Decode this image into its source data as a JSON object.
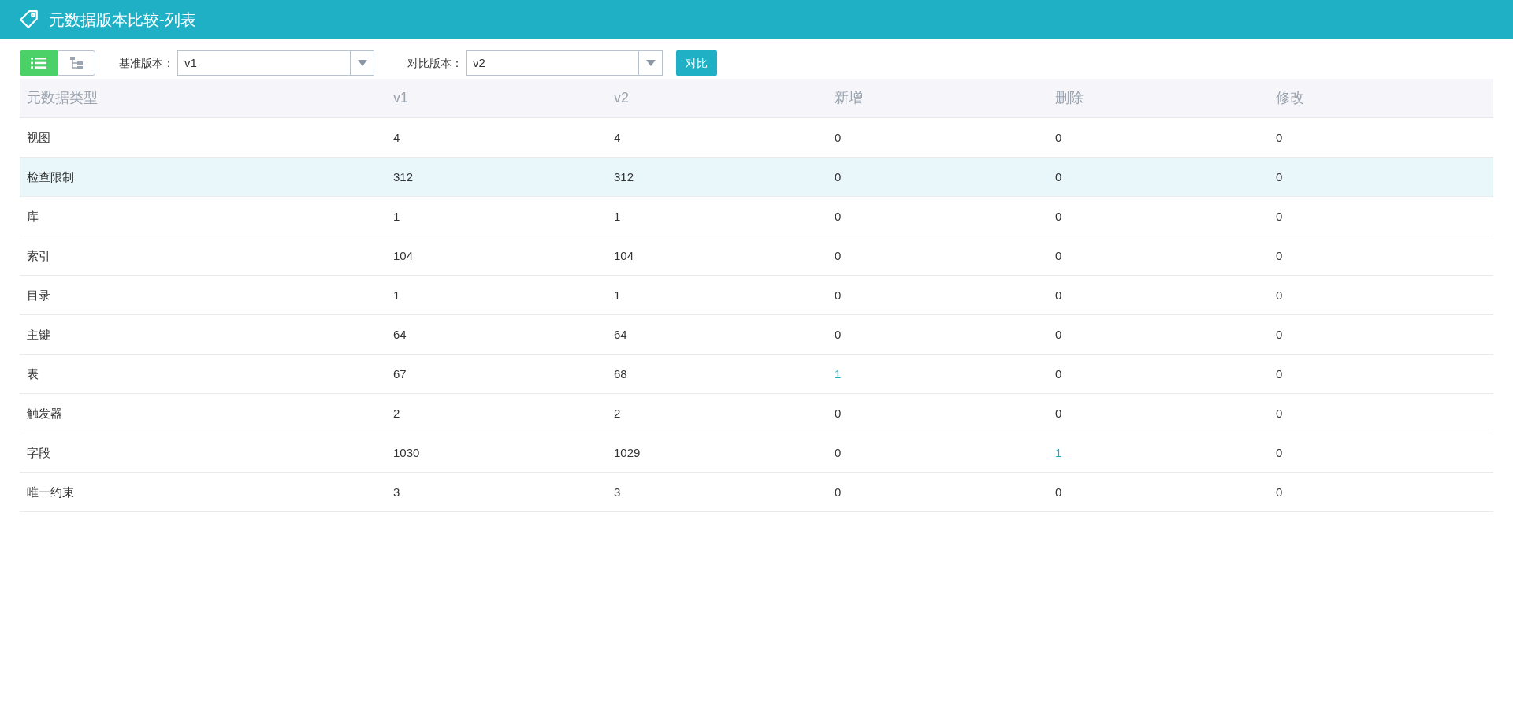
{
  "header": {
    "title": "元数据版本比较-列表"
  },
  "view_toggle": [
    {
      "kind": "list",
      "selected": true
    },
    {
      "kind": "tree",
      "selected": false
    }
  ],
  "base_version": {
    "label": "基准版本：",
    "value": "v1"
  },
  "compare_version": {
    "label": "对比版本：",
    "value": "v2"
  },
  "compare_button": "对比",
  "table": {
    "columns": [
      "元数据类型",
      "v1",
      "v2",
      "新增",
      "删除",
      "修改"
    ],
    "rows": [
      {
        "highlighted": false,
        "cells": [
          {
            "text": "视图",
            "link": false
          },
          {
            "text": "4",
            "link": false
          },
          {
            "text": "4",
            "link": false
          },
          {
            "text": "0",
            "link": false
          },
          {
            "text": "0",
            "link": false
          },
          {
            "text": "0",
            "link": false
          }
        ]
      },
      {
        "highlighted": true,
        "cells": [
          {
            "text": "检查限制",
            "link": false
          },
          {
            "text": "312",
            "link": false
          },
          {
            "text": "312",
            "link": false
          },
          {
            "text": "0",
            "link": false
          },
          {
            "text": "0",
            "link": false
          },
          {
            "text": "0",
            "link": false
          }
        ]
      },
      {
        "highlighted": false,
        "cells": [
          {
            "text": "库",
            "link": false
          },
          {
            "text": "1",
            "link": false
          },
          {
            "text": "1",
            "link": false
          },
          {
            "text": "0",
            "link": false
          },
          {
            "text": "0",
            "link": false
          },
          {
            "text": "0",
            "link": false
          }
        ]
      },
      {
        "highlighted": false,
        "cells": [
          {
            "text": "索引",
            "link": false
          },
          {
            "text": "104",
            "link": false
          },
          {
            "text": "104",
            "link": false
          },
          {
            "text": "0",
            "link": false
          },
          {
            "text": "0",
            "link": false
          },
          {
            "text": "0",
            "link": false
          }
        ]
      },
      {
        "highlighted": false,
        "cells": [
          {
            "text": "目录",
            "link": false
          },
          {
            "text": "1",
            "link": false
          },
          {
            "text": "1",
            "link": false
          },
          {
            "text": "0",
            "link": false
          },
          {
            "text": "0",
            "link": false
          },
          {
            "text": "0",
            "link": false
          }
        ]
      },
      {
        "highlighted": false,
        "cells": [
          {
            "text": "主键",
            "link": false
          },
          {
            "text": "64",
            "link": false
          },
          {
            "text": "64",
            "link": false
          },
          {
            "text": "0",
            "link": false
          },
          {
            "text": "0",
            "link": false
          },
          {
            "text": "0",
            "link": false
          }
        ]
      },
      {
        "highlighted": false,
        "cells": [
          {
            "text": "表",
            "link": false
          },
          {
            "text": "67",
            "link": false
          },
          {
            "text": "68",
            "link": false
          },
          {
            "text": "1",
            "link": true
          },
          {
            "text": "0",
            "link": false
          },
          {
            "text": "0",
            "link": false
          }
        ]
      },
      {
        "highlighted": false,
        "cells": [
          {
            "text": "触发器",
            "link": false
          },
          {
            "text": "2",
            "link": false
          },
          {
            "text": "2",
            "link": false
          },
          {
            "text": "0",
            "link": false
          },
          {
            "text": "0",
            "link": false
          },
          {
            "text": "0",
            "link": false
          }
        ]
      },
      {
        "highlighted": false,
        "cells": [
          {
            "text": "字段",
            "link": false
          },
          {
            "text": "1030",
            "link": false
          },
          {
            "text": "1029",
            "link": false
          },
          {
            "text": "0",
            "link": false
          },
          {
            "text": "1",
            "link": true
          },
          {
            "text": "0",
            "link": false
          }
        ]
      },
      {
        "highlighted": false,
        "cells": [
          {
            "text": "唯一约束",
            "link": false
          },
          {
            "text": "3",
            "link": false
          },
          {
            "text": "3",
            "link": false
          },
          {
            "text": "0",
            "link": false
          },
          {
            "text": "0",
            "link": false
          },
          {
            "text": "0",
            "link": false
          }
        ]
      }
    ]
  }
}
